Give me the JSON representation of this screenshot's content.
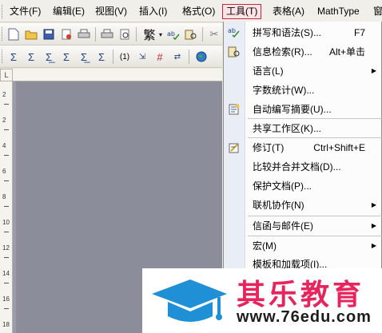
{
  "menubar": {
    "items": [
      "文件(F)",
      "编辑(E)",
      "视图(V)",
      "插入(I)",
      "格式(O)",
      "工具(T)",
      "表格(A)",
      "MathType",
      "窗"
    ],
    "active_index": 5
  },
  "toolbar1": {
    "icons": [
      "new-icon",
      "open-icon",
      "save-icon",
      "permission-icon",
      "print-icon",
      "print-preview-icon",
      "traditional-chinese-icon",
      "spelling-icon",
      "research-icon",
      "cut-icon"
    ],
    "traditional_label": "繁"
  },
  "toolbar2": {
    "icons": [
      "sum-icon",
      "sum-icon",
      "sum-icon",
      "sum-icon",
      "sum-icon",
      "sum-icon",
      "numbered-equation-icon",
      "insert-equation-icon",
      "math-icon",
      "math-icon",
      "globe-icon"
    ],
    "label_1": "(1)"
  },
  "ruler": {
    "corner_label": "L",
    "vertical_numbers": [
      "2",
      "2",
      "4",
      "6",
      "8",
      "10",
      "12",
      "14",
      "16",
      "18"
    ]
  },
  "dropdown": {
    "items": [
      {
        "label": "拼写和语法(S)...",
        "shortcut": "F7",
        "submenu": false,
        "icon": "spelling-check-icon"
      },
      {
        "label": "信息检索(R)...",
        "shortcut": "Alt+单击",
        "submenu": false,
        "icon": "research-icon"
      },
      {
        "label": "语言(L)",
        "shortcut": "",
        "submenu": true,
        "icon": ""
      },
      {
        "label": "字数统计(W)...",
        "shortcut": "",
        "submenu": false,
        "icon": ""
      },
      {
        "label": "自动编写摘要(U)...",
        "shortcut": "",
        "submenu": false,
        "icon": "autosummarize-icon"
      },
      {
        "label": "共享工作区(K)...",
        "shortcut": "",
        "submenu": false,
        "icon": ""
      },
      {
        "label": "修订(T)",
        "shortcut": "Ctrl+Shift+E",
        "submenu": false,
        "icon": "track-changes-icon"
      },
      {
        "label": "比较并合并文档(D)...",
        "shortcut": "",
        "submenu": false,
        "icon": ""
      },
      {
        "label": "保护文档(P)...",
        "shortcut": "",
        "submenu": false,
        "icon": ""
      },
      {
        "label": "联机协作(N)",
        "shortcut": "",
        "submenu": true,
        "icon": ""
      },
      {
        "label": "信函与邮件(E)",
        "shortcut": "",
        "submenu": true,
        "icon": ""
      },
      {
        "label": "宏(M)",
        "shortcut": "",
        "submenu": true,
        "icon": ""
      },
      {
        "label": "模板和加载项(I)...",
        "shortcut": "",
        "submenu": false,
        "icon": ""
      }
    ]
  },
  "watermark": {
    "title": "其乐教育",
    "url": "www.76edu.com"
  },
  "colors": {
    "active_menu_border": "#c8243a",
    "watermark_title": "#e8245c",
    "watermark_logo": "#1f8fd6",
    "document_background": "#8c8d9a"
  }
}
